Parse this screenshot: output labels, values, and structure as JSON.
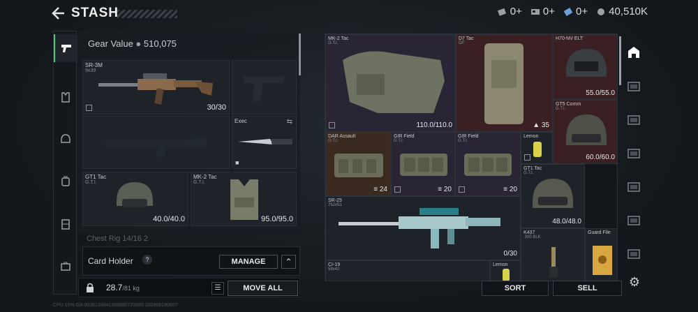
{
  "header": {
    "title": "STASH",
    "currencies": [
      {
        "icon": "ticket-icon",
        "value": "0+"
      },
      {
        "icon": "card-icon",
        "value": "0+"
      },
      {
        "icon": "gem-icon",
        "value": "0+"
      },
      {
        "icon": "coin-icon",
        "value": "40,510K"
      }
    ]
  },
  "left_rail": [
    {
      "name": "weapons",
      "icon": "pistol-icon"
    },
    {
      "name": "armor",
      "icon": "vest-icon"
    },
    {
      "name": "helmet",
      "icon": "helmet-icon"
    },
    {
      "name": "bag",
      "icon": "backpack-icon"
    },
    {
      "name": "rig",
      "icon": "rig-icon"
    },
    {
      "name": "case",
      "icon": "case-icon"
    }
  ],
  "gear": {
    "value_label": "Gear Value",
    "value": "510,075",
    "slots": {
      "primary": {
        "name": "SR-3M",
        "sub": "9x39",
        "value": "30/30"
      },
      "melee": {
        "name": "Exec"
      },
      "helmet": {
        "name": "GT1 Tac",
        "sub": "G.T.I.",
        "value": "40.0/40.0"
      },
      "armor": {
        "name": "MK-2 Tac",
        "sub": "G.T.I.",
        "value": "95.0/95.0"
      },
      "next_row_label": "Chest Rig  14/16  2"
    }
  },
  "card_holder": {
    "label": "Card Holder",
    "help": "?",
    "manage": "MANAGE"
  },
  "weight": {
    "current": "28.7",
    "max": "/81 kg",
    "move_all": "MOVE ALL"
  },
  "status_strip": "CPU 10%   GA 0036134841399880723893 20280818065?",
  "stash": {
    "items": [
      {
        "name": "MK-2 Tac",
        "sub": "G.T.I.",
        "value": "110.0/110.0"
      },
      {
        "name": "D7 Tac",
        "sub": "DF",
        "value": "35"
      },
      {
        "name": "H70-NV ELT",
        "value": "55.0/55.0"
      },
      {
        "name": "GT5 Comm",
        "sub": "G.T.I.",
        "value": "60.0/60.0"
      },
      {
        "name": "DAR Assault",
        "sub": "G.T.I.",
        "value": "24"
      },
      {
        "name": "GIR Field",
        "sub": "G.T.I.",
        "value": "20"
      },
      {
        "name": "GIR Field",
        "sub": "G.T.I.",
        "value": "20"
      },
      {
        "name": "Lemon"
      },
      {
        "name": "GT1 Tac",
        "sub": "G.T.I.",
        "value": "48.0/48.0"
      },
      {
        "name": "SR-25",
        "sub": "762x51",
        "value": "0/30"
      },
      {
        "name": "K437",
        "sub": ".300 BLK"
      },
      {
        "name": "Guard File"
      },
      {
        "name": "CI-19",
        "sub": "58x42"
      },
      {
        "name": "Lemon"
      }
    ]
  },
  "actions": {
    "sort": "SORT",
    "sell": "SELL"
  },
  "colors": {
    "accent_green": "#3fd07a",
    "red_rarity": "#3a2022",
    "brown_rarity": "#3a2a20",
    "purple_rarity": "#2a2535"
  }
}
